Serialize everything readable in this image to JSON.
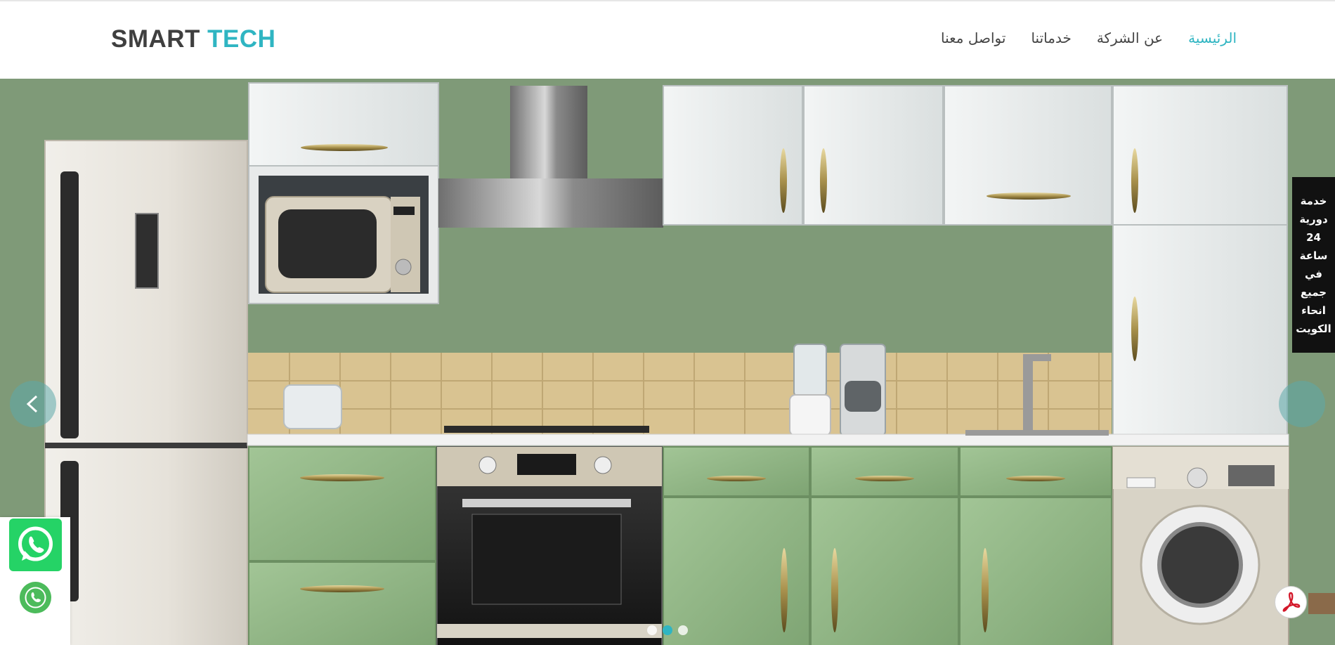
{
  "logo": {
    "part1": "SMART",
    "part2": "TECH"
  },
  "nav": {
    "items": [
      {
        "label": "الرئيسية",
        "active": true
      },
      {
        "label": "عن الشركة",
        "active": false
      },
      {
        "label": "خدماتنا",
        "active": false
      },
      {
        "label": "تواصل معنا",
        "active": false
      }
    ]
  },
  "side_banner": {
    "lines": [
      "خدمة",
      "دورية",
      "24",
      "ساعة",
      "في",
      "جميع",
      "انحاء",
      "الكويت"
    ]
  },
  "slider": {
    "slide_count": 3,
    "active_index": 1
  },
  "floating": {
    "whatsapp_icon": "whatsapp-icon",
    "phone_icon": "phone-icon",
    "pdf_icon": "pdf-icon"
  },
  "colors": {
    "accent": "#2fb5c2",
    "logo_dark": "#3f3f3f",
    "whatsapp": "#25d366",
    "wall": "#7f9a78",
    "cabinet_green": "#8db283"
  }
}
